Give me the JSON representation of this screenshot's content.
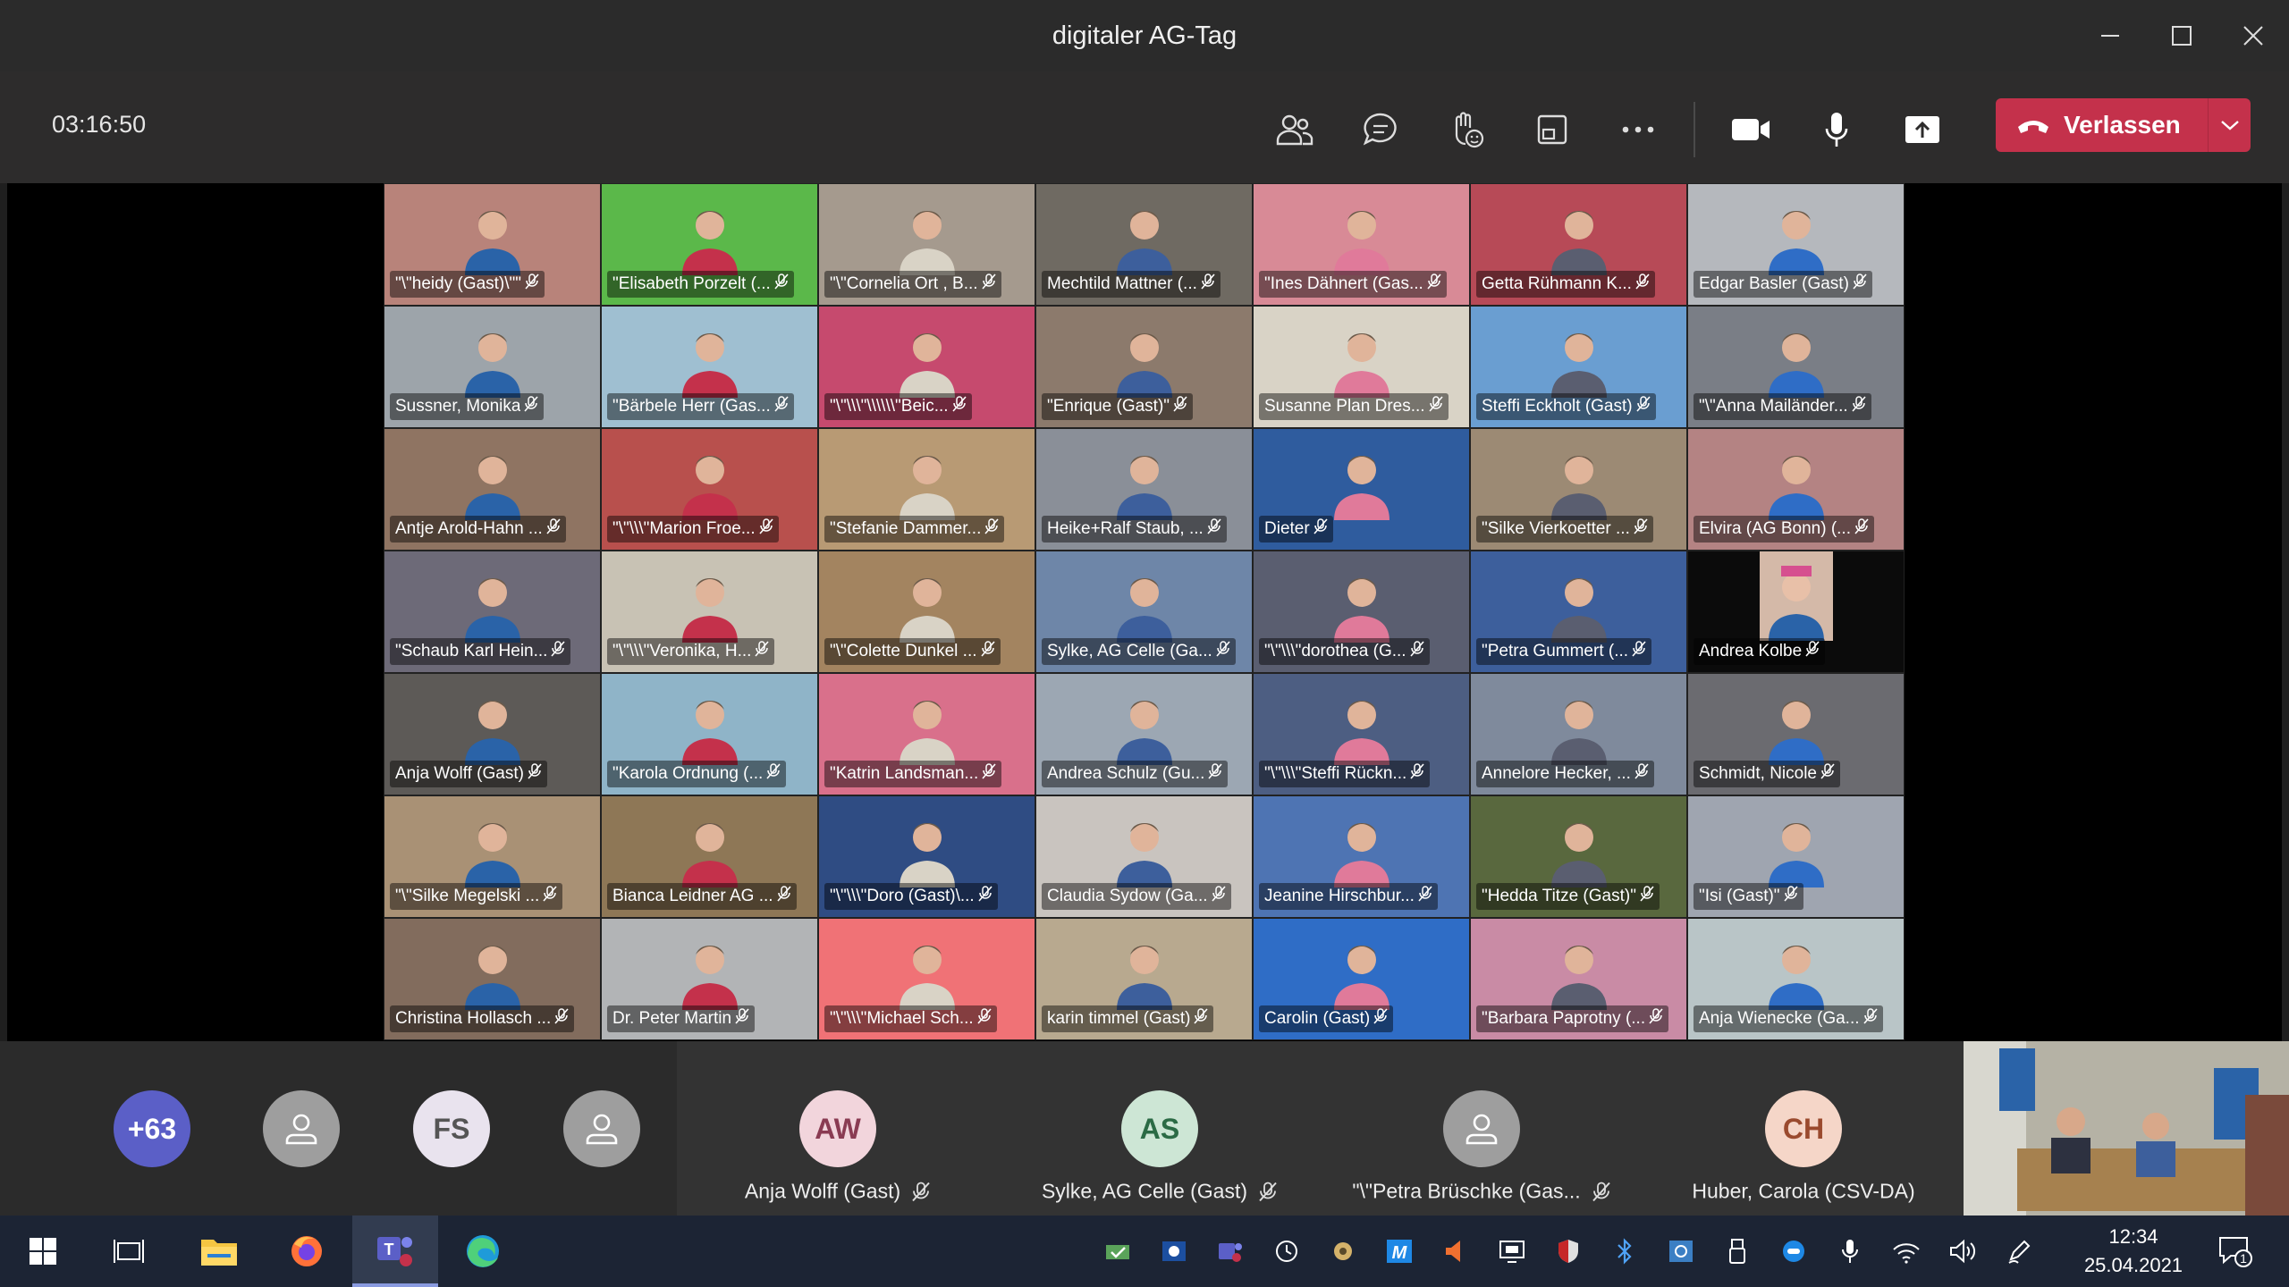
{
  "window": {
    "title": "digitaler AG-Tag"
  },
  "meeting": {
    "timer": "03:16:50",
    "leave_label": "Verlassen"
  },
  "colors": {
    "leave": "#c4314b",
    "avatar_more": "#5b5fc7",
    "aw": "#f2d5dc",
    "as": "#cde6d5",
    "ch": "#f5d6c8"
  },
  "tiles": [
    {
      "label": "\"\\\"heidy (Gast)\\\"\"",
      "bg": "#b8837a"
    },
    {
      "label": "\"Elisabeth Porzelt (...",
      "bg": "#5bb84a"
    },
    {
      "label": "\"\\\"Cornelia Ort , B...",
      "bg": "#a59a8e"
    },
    {
      "label": "Mechtild Mattner (...",
      "bg": "#6f6a62"
    },
    {
      "label": "\"Ines Dähnert (Gas...",
      "bg": "#d88a96"
    },
    {
      "label": "Getta Rühmann K...",
      "bg": "#b74a57"
    },
    {
      "label": "Edgar Basler (Gast)",
      "bg": "#b5b8bd"
    },
    {
      "label": "Sussner, Monika",
      "bg": "#9da4aa"
    },
    {
      "label": "\"Bärbele Herr (Gas...",
      "bg": "#9fbfd1"
    },
    {
      "label": "\"\\\"\\\\\\\"\\\\\\\\\\\\\"Beic...",
      "bg": "#c64a6e"
    },
    {
      "label": "\"Enrique (Gast)\"",
      "bg": "#8c7a6c"
    },
    {
      "label": "Susanne Plan Dres...",
      "bg": "#d9d3c6"
    },
    {
      "label": "Steffi Eckholt (Gast)",
      "bg": "#6a9ed1"
    },
    {
      "label": "\"\\\"Anna Mailänder...",
      "bg": "#7a7e86"
    },
    {
      "label": "Antje Arold-Hahn ...",
      "bg": "#8f7462"
    },
    {
      "label": "\"\\\"\\\\\\\"Marion Froe...",
      "bg": "#b8504d"
    },
    {
      "label": "\"Stefanie Dammer...",
      "bg": "#b89a74"
    },
    {
      "label": "Heike+Ralf Staub, ...",
      "bg": "#8a8f98"
    },
    {
      "label": "Dieter",
      "bg": "#2f5c9e"
    },
    {
      "label": "\"Silke Vierkoetter ...",
      "bg": "#9c8a74"
    },
    {
      "label": "Elvira (AG Bonn) (...",
      "bg": "#b48383"
    },
    {
      "label": "\"Schaub Karl Hein...",
      "bg": "#6d6a78"
    },
    {
      "label": "\"\\\"\\\\\\\"Veronika, H...",
      "bg": "#c8c2b4"
    },
    {
      "label": "\"\\\"Colette Dunkel ...",
      "bg": "#a38460"
    },
    {
      "label": "Sylke, AG Celle (Ga...",
      "bg": "#6e86a8"
    },
    {
      "label": "\"\\\"\\\\\\\"dorothea (G...",
      "bg": "#5a5e70"
    },
    {
      "label": "\"Petra Gummert (...",
      "bg": "#3d5f9c"
    },
    {
      "label": "Andrea Kolbe",
      "bg": "#0b0b0b"
    },
    {
      "label": "Anja Wolff (Gast)",
      "bg": "#5d5a57"
    },
    {
      "label": "\"Karola Ordnung (...",
      "bg": "#8fb4c8"
    },
    {
      "label": "\"Katrin Landsman...",
      "bg": "#d9708b"
    },
    {
      "label": "Andrea Schulz (Gu...",
      "bg": "#9ca7b3"
    },
    {
      "label": "\"\\\"\\\\\\\"Steffi Rückn...",
      "bg": "#4d5e82"
    },
    {
      "label": "Annelore Hecker, ...",
      "bg": "#7f8a9c"
    },
    {
      "label": "Schmidt, Nicole",
      "bg": "#6b6b70"
    },
    {
      "label": "\"\\\"Silke Megelski ...",
      "bg": "#a99175"
    },
    {
      "label": "Bianca Leidner AG ...",
      "bg": "#8e7756"
    },
    {
      "label": "\"\\\"\\\\\\\"Doro (Gast)\\...",
      "bg": "#2f4c83"
    },
    {
      "label": "Claudia Sydow (Ga...",
      "bg": "#c9c4bf"
    },
    {
      "label": "Jeanine Hirschbur...",
      "bg": "#4e74b3"
    },
    {
      "label": "\"Hedda Titze (Gast)\"",
      "bg": "#59683e"
    },
    {
      "label": "\"Isi (Gast)\"",
      "bg": "#9fa5b0"
    },
    {
      "label": "Christina Hollasch ...",
      "bg": "#826c5d"
    },
    {
      "label": "Dr. Peter Martin",
      "bg": "#b2b4b6"
    },
    {
      "label": "\"\\\"\\\\\\\"Michael Sch...",
      "bg": "#f07276"
    },
    {
      "label": "karin timmel (Gast)",
      "bg": "#b8a98f"
    },
    {
      "label": "Carolin (Gast)",
      "bg": "#2f6dc6"
    },
    {
      "label": "\"Barbara Paprotny (...",
      "bg": "#c98ba5"
    },
    {
      "label": "Anja Wienecke (Ga...",
      "bg": "#b9c5c7"
    }
  ],
  "overflow": {
    "more_count": "+63",
    "avatars": [
      {
        "initials": "FS"
      }
    ]
  },
  "participants": [
    {
      "initials": "AW",
      "name": "Anja Wolff (Gast)"
    },
    {
      "initials": "AS",
      "name": "Sylke, AG Celle (Gast)"
    },
    {
      "initials": "",
      "name": "\"\\\"Petra Brüschke (Gas..."
    },
    {
      "initials": "CH",
      "name": "Huber, Carola (CSV-DA)"
    }
  ],
  "taskbar": {
    "time": "12:34",
    "date": "25.04.2021",
    "notification_count": "1"
  }
}
